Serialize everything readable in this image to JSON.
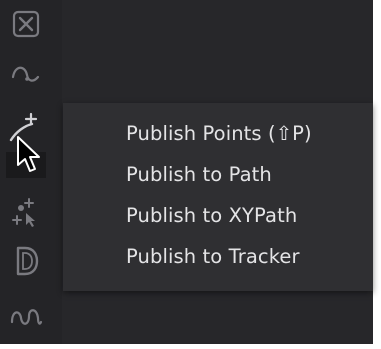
{
  "toolbar": {
    "tools": [
      {
        "icon": "close-box-icon"
      },
      {
        "icon": "bezier-curve-icon"
      },
      {
        "icon": "publish-points-icon",
        "active": true
      },
      {
        "icon": "point-select-icon"
      },
      {
        "icon": "d-shape-icon"
      },
      {
        "icon": "wave-path-icon"
      }
    ]
  },
  "menu": {
    "items": [
      {
        "label": "Publish Points (⇧P)"
      },
      {
        "label": "Publish to Path"
      },
      {
        "label": "Publish to XYPath"
      },
      {
        "label": "Publish to Tracker"
      }
    ]
  },
  "colors": {
    "panel": "#27272a",
    "menu": "#2f2f32",
    "text": "#e4e4e6",
    "icon": "#8c8c92"
  }
}
